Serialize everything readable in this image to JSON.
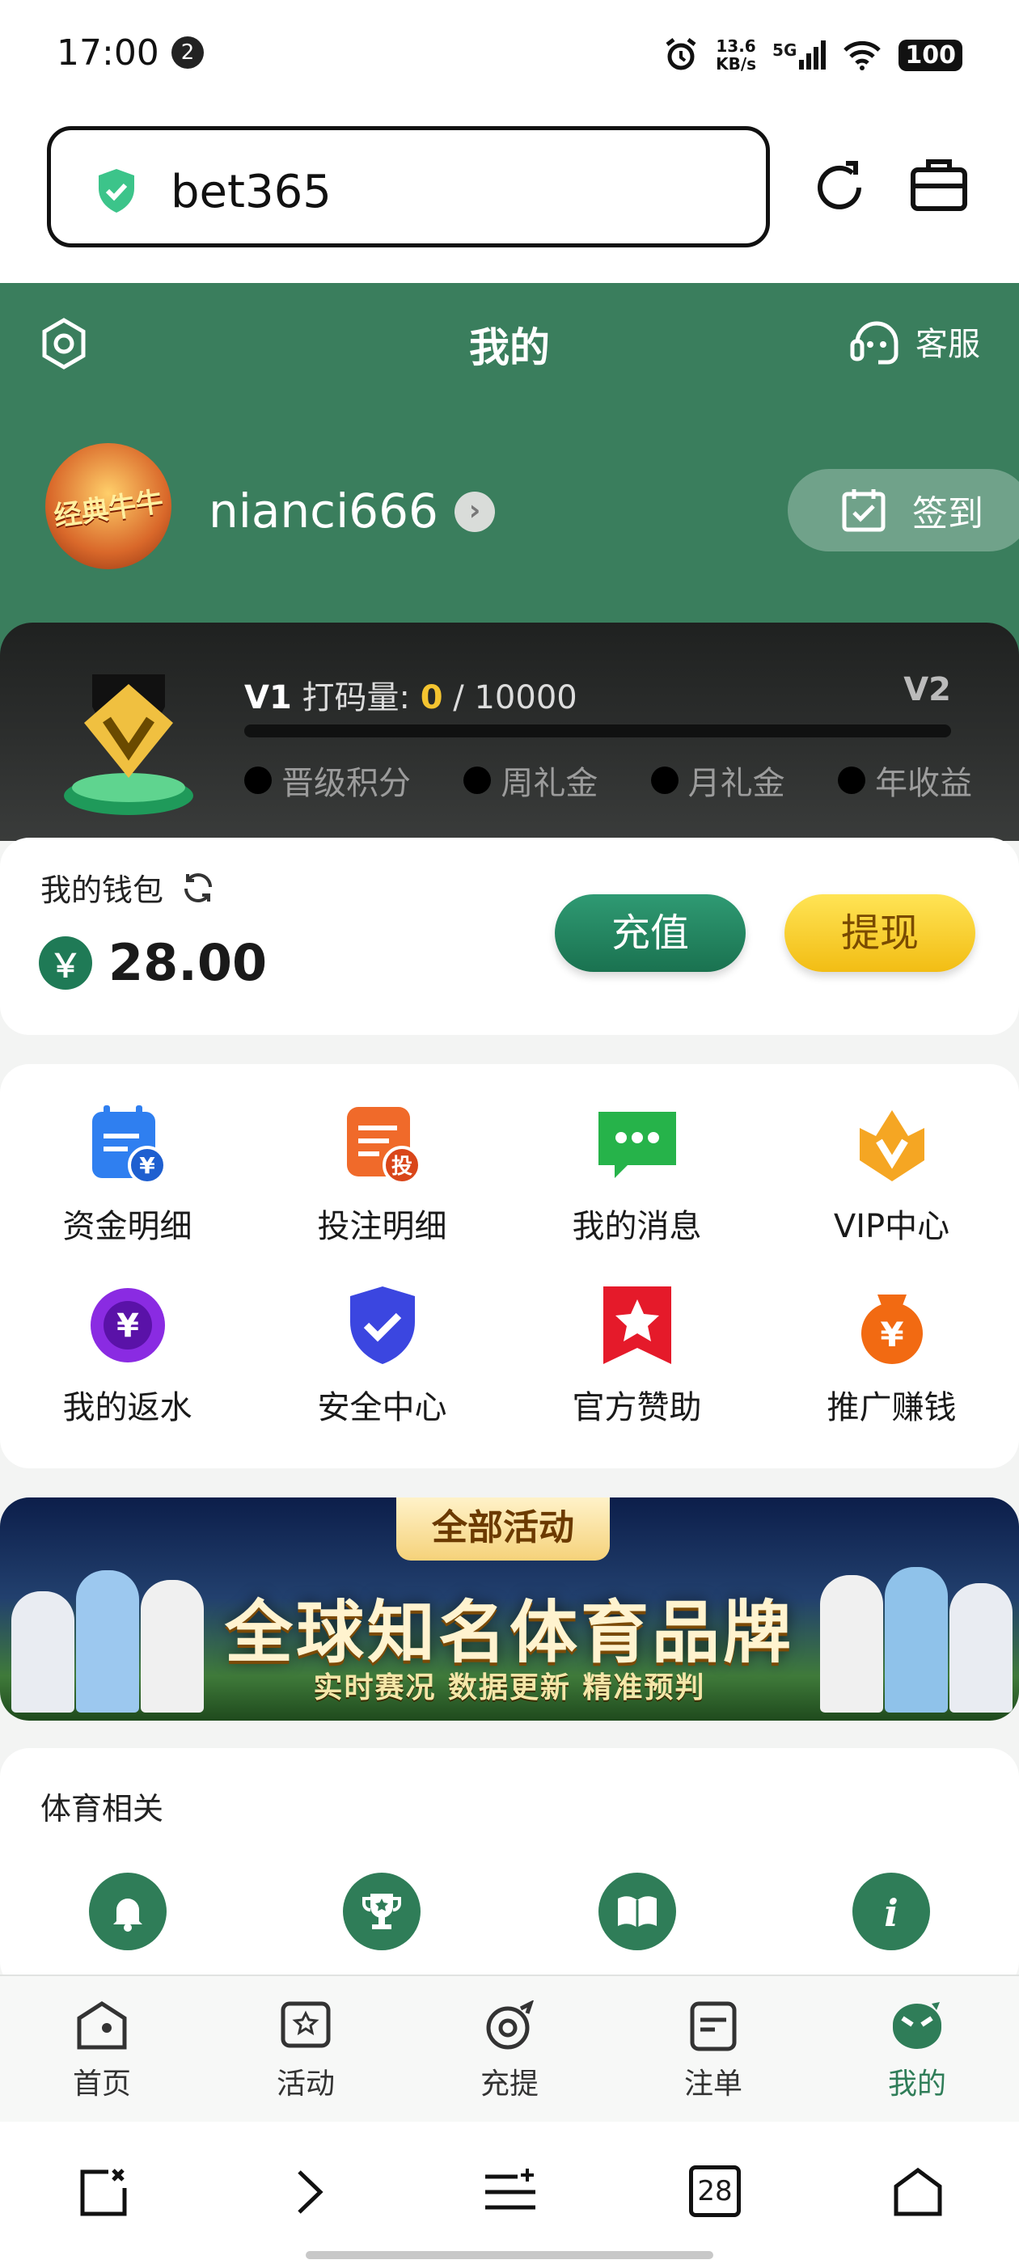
{
  "status_bar": {
    "time": "17:00",
    "notification_count": "2",
    "net_speed_value": "13.6",
    "net_speed_unit": "KB/s",
    "network": "5G",
    "battery": "100"
  },
  "browser": {
    "url": "bet365",
    "tabs_count": "28"
  },
  "header": {
    "title": "我的",
    "service_label": "客服"
  },
  "user": {
    "avatar_text": "经典牛牛",
    "username": "nianci666",
    "checkin_label": "签到"
  },
  "vip": {
    "current_level": "V1",
    "progress_label": "打码量:",
    "progress_current": "0",
    "progress_sep": "/ 10000",
    "progress_fraction": 0.0,
    "next_level": "V2",
    "perks": [
      "晋级积分",
      "周礼金",
      "月礼金",
      "年收益"
    ]
  },
  "wallet": {
    "label": "我的钱包",
    "currency_symbol": "￥",
    "balance": "28.00",
    "deposit_label": "充值",
    "withdraw_label": "提现"
  },
  "menu": [
    {
      "label": "资金明细",
      "icon": "fund-details-icon"
    },
    {
      "label": "投注明细",
      "icon": "bet-details-icon"
    },
    {
      "label": "我的消息",
      "icon": "message-icon"
    },
    {
      "label": "VIP中心",
      "icon": "vip-crown-icon"
    },
    {
      "label": "我的返水",
      "icon": "rebate-chip-icon"
    },
    {
      "label": "安全中心",
      "icon": "security-shield-icon"
    },
    {
      "label": "官方赞助",
      "icon": "sponsor-star-icon"
    },
    {
      "label": "推广赚钱",
      "icon": "promote-coin-icon"
    }
  ],
  "banner": {
    "tag": "全部活动",
    "headline": "全球知名体育品牌",
    "subline": "实时赛况 数据更新 精准预判"
  },
  "sports": {
    "title": "体育相关",
    "icons": [
      "bell-icon",
      "trophy-icon",
      "book-icon",
      "info-icon"
    ]
  },
  "app_nav": [
    {
      "label": "首页",
      "icon": "home-icon"
    },
    {
      "label": "活动",
      "icon": "activity-icon"
    },
    {
      "label": "充提",
      "icon": "deposit-withdraw-icon"
    },
    {
      "label": "注单",
      "icon": "bet-slip-icon"
    },
    {
      "label": "我的",
      "icon": "profile-icon",
      "active": true
    }
  ],
  "colors": {
    "brand_green": "#3a7e5d",
    "gold": "#f4c430"
  }
}
